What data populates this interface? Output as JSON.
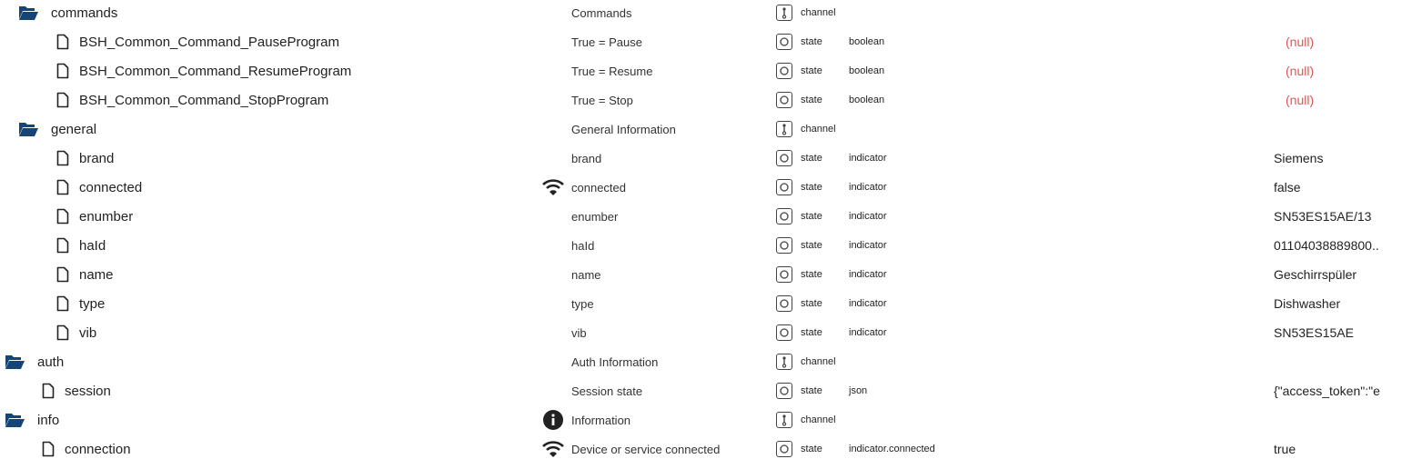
{
  "colors": {
    "folder": "#164477",
    "null": "#e05555"
  },
  "rows": [
    {
      "id": "commands",
      "kind": "folder",
      "level": 1,
      "name": "Commands",
      "type": "channel",
      "role": "",
      "value": ""
    },
    {
      "id": "BSH_Common_Command_PauseProgram",
      "kind": "file",
      "level": 2,
      "name": "True = Pause",
      "type": "state",
      "role": "boolean",
      "value": "(null)"
    },
    {
      "id": "BSH_Common_Command_ResumeProgram",
      "kind": "file",
      "level": 2,
      "name": "True = Resume",
      "type": "state",
      "role": "boolean",
      "value": "(null)"
    },
    {
      "id": "BSH_Common_Command_StopProgram",
      "kind": "file",
      "level": 2,
      "name": "True = Stop",
      "type": "state",
      "role": "boolean",
      "value": "(null)"
    },
    {
      "id": "general",
      "kind": "folder",
      "level": 1,
      "name": "General Information",
      "type": "channel",
      "role": "",
      "value": ""
    },
    {
      "id": "brand",
      "kind": "file",
      "level": 2,
      "name": "brand",
      "type": "state",
      "role": "indicator",
      "value": "Siemens"
    },
    {
      "id": "connected",
      "kind": "file",
      "level": 2,
      "name": "connected",
      "nameIcon": "wifi-icon",
      "type": "state",
      "role": "indicator",
      "value": "false"
    },
    {
      "id": "enumber",
      "kind": "file",
      "level": 2,
      "name": "enumber",
      "type": "state",
      "role": "indicator",
      "value": "SN53ES15AE/13"
    },
    {
      "id": "haId",
      "kind": "file",
      "level": 2,
      "name": "haId",
      "type": "state",
      "role": "indicator",
      "value": "01104038889800.."
    },
    {
      "id": "name",
      "kind": "file",
      "level": 2,
      "name": "name",
      "type": "state",
      "role": "indicator",
      "value": "Geschirrspüler"
    },
    {
      "id": "type",
      "kind": "file",
      "level": 2,
      "name": "type",
      "type": "state",
      "role": "indicator",
      "value": "Dishwasher"
    },
    {
      "id": "vib",
      "kind": "file",
      "level": 2,
      "name": "vib",
      "type": "state",
      "role": "indicator",
      "value": "SN53ES15AE"
    },
    {
      "id": "auth",
      "kind": "folder",
      "level": 0,
      "name": "Auth Information",
      "type": "channel",
      "role": "",
      "value": ""
    },
    {
      "id": "session",
      "kind": "file",
      "level": 1,
      "name": "Session state",
      "type": "state",
      "role": "json",
      "value": "{\"access_token\":\"e"
    },
    {
      "id": "info",
      "kind": "folder",
      "level": 0,
      "name": "Information",
      "nameIcon": "info-icon",
      "type": "channel",
      "role": "",
      "value": ""
    },
    {
      "id": "connection",
      "kind": "file",
      "level": 1,
      "name": "Device or service connected",
      "nameIcon": "wifi-icon",
      "type": "state",
      "role": "indicator.connected",
      "value": "true"
    }
  ]
}
